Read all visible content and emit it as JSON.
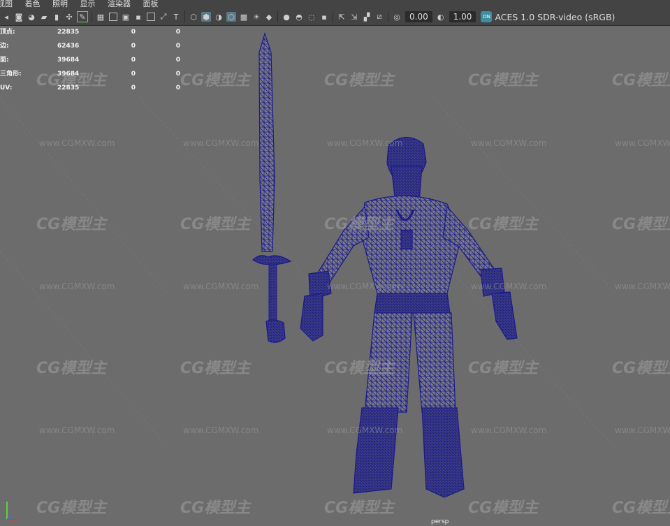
{
  "menu": [
    "视图",
    "着色",
    "照明",
    "显示",
    "渲染器",
    "面板"
  ],
  "toolbar": {
    "exposure_value": "0.00",
    "gamma_value": "1.00",
    "color_space": "ACES 1.0 SDR-video (sRGB)"
  },
  "stats": [
    {
      "label": "顶点:",
      "v1": "22835",
      "v2": "0",
      "v3": "0"
    },
    {
      "label": "边:",
      "v1": "62436",
      "v2": "0",
      "v3": "0"
    },
    {
      "label": "面:",
      "v1": "39684",
      "v2": "0",
      "v3": "0"
    },
    {
      "label": "三角形:",
      "v1": "39684",
      "v2": "0",
      "v3": "0"
    },
    {
      "label": "UV:",
      "v1": "22835",
      "v2": "0",
      "v3": "0"
    }
  ],
  "watermark": {
    "logo": "CG模型主",
    "url": "www.CGMXW.com"
  },
  "camera_label": "persp",
  "colors": {
    "wireframe": "#1a1a8c",
    "viewport_bg": "#6c6c6c",
    "toolbar_bg": "#444444"
  }
}
